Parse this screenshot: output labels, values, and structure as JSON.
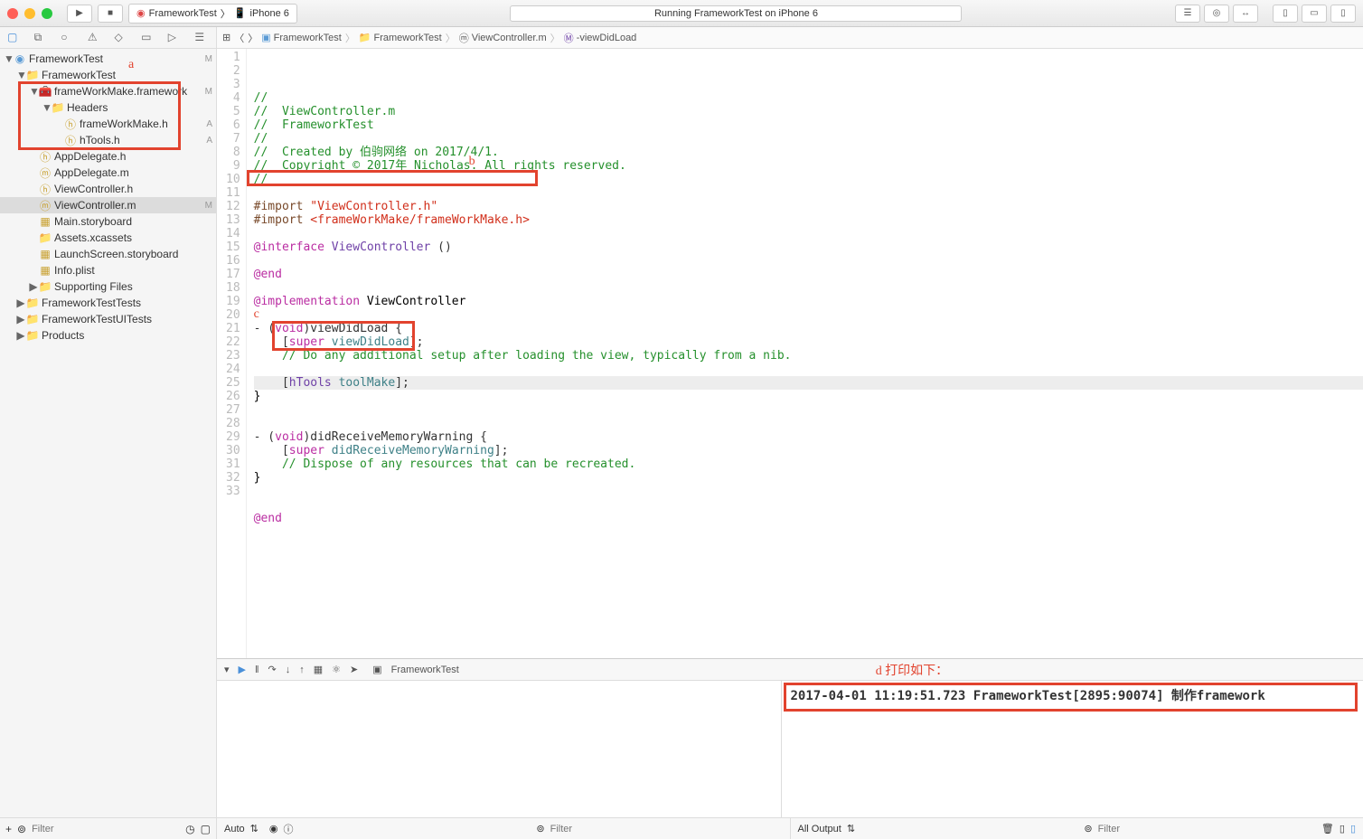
{
  "toolbar": {
    "scheme_name": "FrameworkTest",
    "device_name": "iPhone 6",
    "status_text": "Running FrameworkTest on iPhone 6"
  },
  "breadcrumb": {
    "items": [
      "FrameworkTest",
      "FrameworkTest",
      "ViewController.m",
      "-viewDidLoad"
    ]
  },
  "tree": {
    "root": {
      "label": "FrameworkTest",
      "status": "M"
    },
    "items": [
      {
        "label": "FrameworkTest",
        "icon": "folder",
        "indent": 1,
        "status": ""
      },
      {
        "label": "frameWorkMake.framework",
        "icon": "toolbox",
        "indent": 2,
        "status": "M"
      },
      {
        "label": "Headers",
        "icon": "folder-blue",
        "indent": 3,
        "status": ""
      },
      {
        "label": "frameWorkMake.h",
        "icon": "h",
        "indent": 4,
        "status": "A"
      },
      {
        "label": "hTools.h",
        "icon": "h",
        "indent": 4,
        "status": "A"
      },
      {
        "label": "AppDelegate.h",
        "icon": "h",
        "indent": 2,
        "status": ""
      },
      {
        "label": "AppDelegate.m",
        "icon": "m",
        "indent": 2,
        "status": ""
      },
      {
        "label": "ViewController.h",
        "icon": "h",
        "indent": 2,
        "status": ""
      },
      {
        "label": "ViewController.m",
        "icon": "m",
        "indent": 2,
        "status": "M",
        "selected": true
      },
      {
        "label": "Main.storyboard",
        "icon": "sb",
        "indent": 2,
        "status": ""
      },
      {
        "label": "Assets.xcassets",
        "icon": "assets",
        "indent": 2,
        "status": ""
      },
      {
        "label": "LaunchScreen.storyboard",
        "icon": "sb",
        "indent": 2,
        "status": ""
      },
      {
        "label": "Info.plist",
        "icon": "plist",
        "indent": 2,
        "status": ""
      },
      {
        "label": "Supporting Files",
        "icon": "folder",
        "indent": 2,
        "status": ""
      },
      {
        "label": "FrameworkTestTests",
        "icon": "folder",
        "indent": 1,
        "status": ""
      },
      {
        "label": "FrameworkTestUITests",
        "icon": "folder",
        "indent": 1,
        "status": ""
      },
      {
        "label": "Products",
        "icon": "folder",
        "indent": 1,
        "status": ""
      }
    ]
  },
  "code": {
    "lines": [
      {
        "n": 1,
        "txt": "//"
      },
      {
        "n": 2,
        "txt": "//  ViewController.m"
      },
      {
        "n": 3,
        "txt": "//  FrameworkTest"
      },
      {
        "n": 4,
        "txt": "//"
      },
      {
        "n": 5,
        "txt": "//  Created by 伯驹网络 on 2017/4/1."
      },
      {
        "n": 6,
        "txt": "//  Copyright © 2017年 Nicholas. All rights reserved."
      },
      {
        "n": 7,
        "txt": "//"
      },
      {
        "n": 8,
        "txt": ""
      },
      {
        "n": 9,
        "txt": "#import \"ViewController.h\""
      },
      {
        "n": 10,
        "txt": "#import <frameWorkMake/frameWorkMake.h>"
      },
      {
        "n": 11,
        "txt": ""
      },
      {
        "n": 12,
        "txt": "@interface ViewController ()"
      },
      {
        "n": 13,
        "txt": ""
      },
      {
        "n": 14,
        "txt": "@end"
      },
      {
        "n": 15,
        "txt": ""
      },
      {
        "n": 16,
        "txt": "@implementation ViewController"
      },
      {
        "n": 17,
        "txt": ""
      },
      {
        "n": 18,
        "txt": "- (void)viewDidLoad {"
      },
      {
        "n": 19,
        "txt": "    [super viewDidLoad];"
      },
      {
        "n": 20,
        "txt": "    // Do any additional setup after loading the view, typically from a nib."
      },
      {
        "n": 21,
        "txt": "    "
      },
      {
        "n": 22,
        "txt": "    [hTools toolMake];"
      },
      {
        "n": 23,
        "txt": "}"
      },
      {
        "n": 24,
        "txt": ""
      },
      {
        "n": 25,
        "txt": ""
      },
      {
        "n": 26,
        "txt": "- (void)didReceiveMemoryWarning {"
      },
      {
        "n": 27,
        "txt": "    [super didReceiveMemoryWarning];"
      },
      {
        "n": 28,
        "txt": "    // Dispose of any resources that can be recreated."
      },
      {
        "n": 29,
        "txt": "}"
      },
      {
        "n": 30,
        "txt": ""
      },
      {
        "n": 31,
        "txt": ""
      },
      {
        "n": 32,
        "txt": "@end"
      },
      {
        "n": 33,
        "txt": ""
      }
    ]
  },
  "annotations": {
    "a": "a",
    "b": "b",
    "c": "c",
    "d": "d 打印如下："
  },
  "debug": {
    "process_label": "FrameworkTest",
    "console_output": "2017-04-01 11:19:51.723 FrameworkTest[2895:90074] 制作framework",
    "left_bottom": {
      "auto": "Auto"
    },
    "right_bottom": {
      "output": "All Output"
    },
    "filter_placeholder": "Filter"
  },
  "sidebar_filter_placeholder": "Filter"
}
